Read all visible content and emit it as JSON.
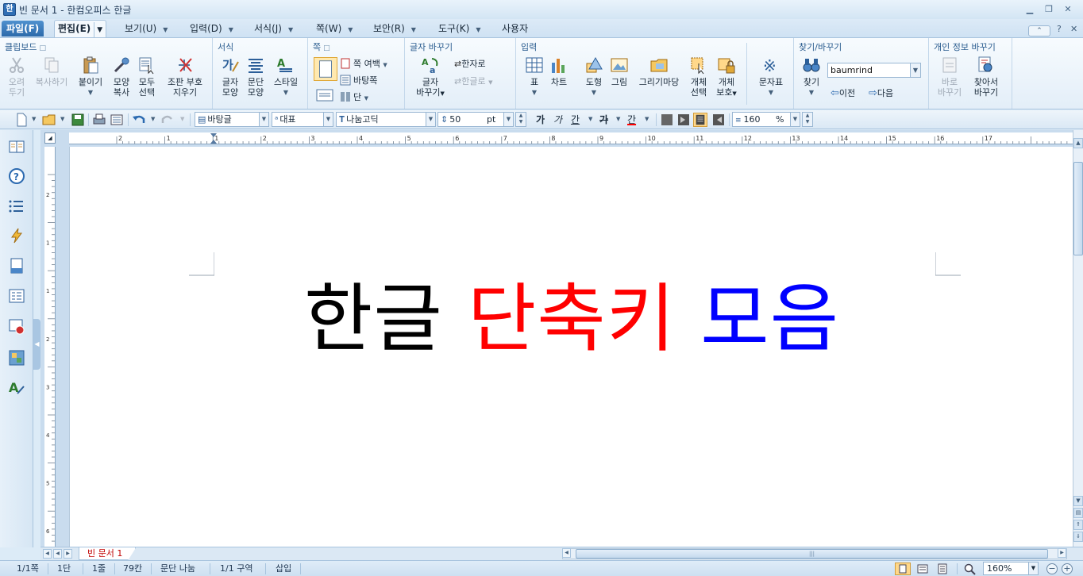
{
  "window": {
    "app_icon_letter": "한",
    "title": "빈 문서 1 - 한컴오피스 한글"
  },
  "menu": {
    "file": "파일(F)",
    "edit": "편집(E)",
    "items": [
      "보기(U)",
      "입력(D)",
      "서식(J)",
      "쪽(W)",
      "보안(R)",
      "도구(K)",
      "사용자"
    ],
    "help": "?"
  },
  "ribbon": {
    "clipboard": {
      "title": "클립보드",
      "cut": [
        "오려",
        "두기"
      ],
      "copy": "복사하기",
      "paste": "붙이기",
      "format_copy": [
        "모양",
        "복사"
      ],
      "select_all": [
        "모두",
        "선택"
      ],
      "hide_marks": [
        "조판 부호",
        "지우기"
      ]
    },
    "format": {
      "title": "서식",
      "char_shape": [
        "글자",
        "모양"
      ],
      "para_shape": [
        "문단",
        "모양"
      ],
      "style": "스타일"
    },
    "page": {
      "title": "쪽",
      "margin": "쪽 여백",
      "background": "바탕쪽",
      "column": "단"
    },
    "replace": {
      "title": "글자 바꾸기",
      "convert": [
        "글자",
        "바꾸기"
      ],
      "to_hanja": "한자로",
      "to_hangul": "한글로"
    },
    "insert": {
      "title": "입력",
      "table": "표",
      "chart": "차트",
      "shape": "도형",
      "picture": "그림",
      "drawing": "그리기마당",
      "object_select": [
        "개체",
        "선택"
      ],
      "object_protect": [
        "개체",
        "보호"
      ],
      "symbols": "문자표"
    },
    "find": {
      "title": "찾기/바꾸기",
      "find": "찾기",
      "query": "baumrind",
      "prev": "이전",
      "next": "다음"
    },
    "privacy": {
      "title": "개인 정보 바꾸기",
      "replace_now": [
        "바로",
        "바꾸기"
      ],
      "find_replace": [
        "찾아서",
        "바꾸기"
      ]
    }
  },
  "toolbar": {
    "style": "바탕글",
    "language": "대표",
    "font": "나눔고딕",
    "font_size": "50",
    "size_unit": "pt",
    "bold": "가",
    "italic": "가",
    "underline": "간",
    "strike": "가",
    "color": "간",
    "line_spacing": "160",
    "spacing_unit": "%"
  },
  "document": {
    "word1": "한글",
    "word2": "단축키",
    "word3": "모음",
    "colors": {
      "word1": "#000000",
      "word2": "#ff0000",
      "word3": "#0000ff"
    }
  },
  "tabs": {
    "doc_tab": "빈 문서 1"
  },
  "ruler": {
    "h_ticks": [
      "2",
      "1",
      "1",
      "2",
      "3",
      "4",
      "5",
      "6",
      "7",
      "8",
      "9",
      "10",
      "11",
      "12",
      "13",
      "14",
      "15",
      "16",
      "17"
    ],
    "v_ticks": [
      "2",
      "1",
      "1",
      "2",
      "3",
      "4",
      "5",
      "6"
    ]
  },
  "status": {
    "page": "1/1쪽",
    "column": "1단",
    "line": "1줄",
    "col": "79칸",
    "break": "문단 나눔",
    "section": "1/1 구역",
    "mode": "삽입",
    "zoom": "160%"
  },
  "icons": {
    "sidebar": [
      "book-icon",
      "help-circle-icon",
      "list-icon",
      "lightning-icon",
      "page-icon",
      "form-icon",
      "screen-record-icon",
      "puzzle-icon",
      "font-icon"
    ]
  }
}
